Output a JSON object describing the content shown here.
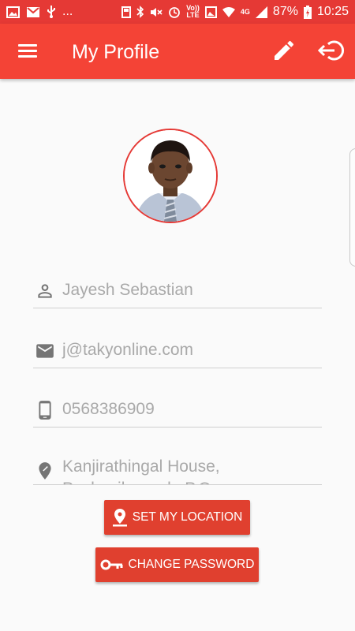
{
  "status_bar": {
    "left_icons": [
      "image-icon",
      "mail-icon",
      "usb-icon",
      "more-notifications-icon"
    ],
    "more_text": "...",
    "volte": "Vo))",
    "lte": "LTE",
    "network": "4G",
    "battery_percent": "87%",
    "time": "10:25"
  },
  "app_bar": {
    "title": "My Profile",
    "icons": [
      "menu-icon",
      "edit-icon",
      "logout-icon"
    ]
  },
  "profile": {
    "name": "Jayesh Sebastian",
    "email": "j@takyonline.com",
    "phone": "0568386909",
    "address": "Kanjirathingal House, Pazhuvilangadu P.O."
  },
  "buttons": {
    "set_location": "SET MY LOCATION",
    "change_password": "CHANGE PASSWORD"
  },
  "colors": {
    "status_bar": "#e53935",
    "app_bar": "#f44336",
    "button": "#e0402f",
    "field_text": "#a9a9a9",
    "icon_gray": "#757575"
  }
}
